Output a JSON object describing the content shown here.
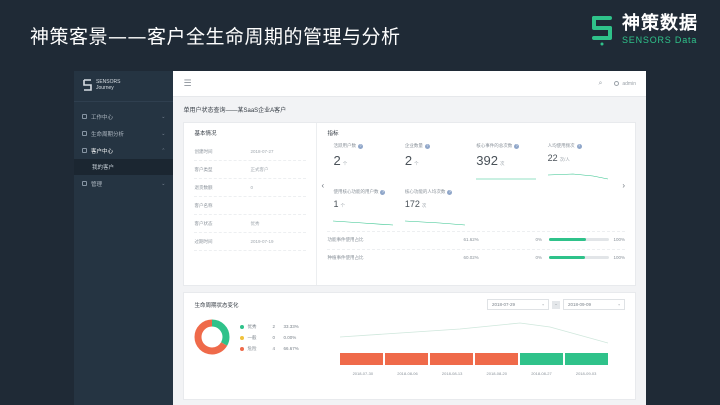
{
  "slide": {
    "title": "神策客景——客户全生命周期的管理与分析",
    "logo_cn": "神策数据",
    "logo_en": "SENSORS Data"
  },
  "sidebar": {
    "logo_text_1": "SENSORS",
    "logo_text_2": "Journey",
    "items": [
      {
        "label": "工作中心",
        "icon": "home-icon"
      },
      {
        "label": "生命周期分析",
        "icon": "chart-icon"
      },
      {
        "label": "客户中心",
        "icon": "user-icon"
      },
      {
        "label": "管理",
        "icon": "settings-icon"
      }
    ],
    "sub_item": "我的客户"
  },
  "topbar": {
    "menu_icon": "menu-icon",
    "search_icon": "search-icon",
    "user": "admin"
  },
  "page": {
    "title": "单用户状态查询——某SaaS企业A客户"
  },
  "basic_info": {
    "heading": "基本情况",
    "rows": [
      {
        "k": "创建时间",
        "v": "2018-07-27"
      },
      {
        "k": "客户类型",
        "v": "正式客户"
      },
      {
        "k": "退货数额",
        "v": "0"
      },
      {
        "k": "客户名称",
        "v": ""
      },
      {
        "k": "客户状态",
        "v": "优秀"
      },
      {
        "k": "过期时间",
        "v": "2019-07-19"
      }
    ]
  },
  "metrics": {
    "heading": "指标",
    "items": [
      {
        "label": "活跃用户数",
        "value": "2",
        "unit": "个"
      },
      {
        "label": "企业数量",
        "value": "2",
        "unit": "个"
      },
      {
        "label": "核心事件的总次数",
        "value": "392",
        "unit": "次"
      },
      {
        "label": "人均使用频次",
        "value": "22",
        "unit": "次/人"
      },
      {
        "label": "使用核心功能的用户数",
        "value": "1",
        "unit": "个"
      },
      {
        "label": "核心功能的人均次数",
        "value": "172",
        "unit": "次"
      }
    ],
    "rates": [
      {
        "name": "功能事件使用占比",
        "pct": "61.62%",
        "lo": "0%",
        "hi": "100%",
        "value": 0.6162
      },
      {
        "name": "种植事件使用占比",
        "pct": "60.02%",
        "lo": "0%",
        "hi": "100%",
        "value": 0.6002
      }
    ]
  },
  "lifecycle": {
    "title": "生命周期状态变化",
    "date_start": "2018-07-29",
    "date_end": "2018-09-09",
    "legend": [
      {
        "name": "优秀",
        "num": "2",
        "pct": "33.33%",
        "color": "#2fc28a"
      },
      {
        "name": "一般",
        "num": "0",
        "pct": "0.00%",
        "color": "#f0c23c"
      },
      {
        "name": "危险",
        "num": "4",
        "pct": "66.67%",
        "color": "#ef6a4a"
      }
    ],
    "dates": [
      "2018-07-30",
      "2018-08-06",
      "2018-08-13",
      "2018-08-20",
      "2018-08-27",
      "2018-09-03"
    ],
    "states": [
      "danger",
      "danger",
      "danger",
      "danger",
      "good",
      "good"
    ],
    "state_colors": {
      "danger": "#ef6a4a",
      "good": "#2fc28a"
    }
  }
}
